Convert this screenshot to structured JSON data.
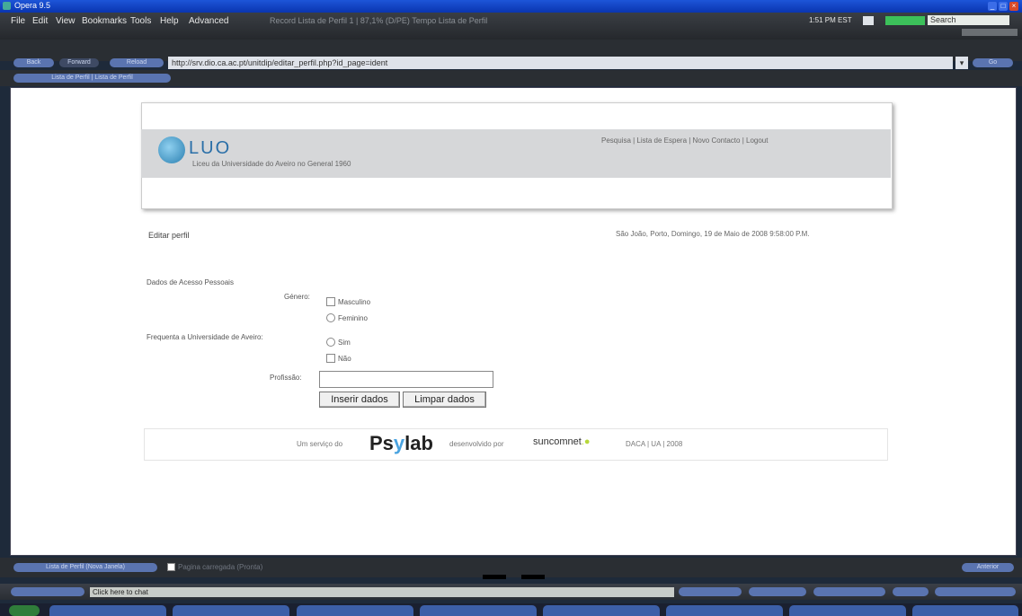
{
  "window": {
    "title": "Opera 9.5"
  },
  "menu": {
    "items": [
      "File",
      "Edit",
      "View",
      "Bookmarks",
      "Tools",
      "Help",
      "Advanced"
    ],
    "faint_text": "Record Lista de Perfil 1 | 87,1%  (D/PE)  Tempo Lista de Perfil",
    "clock": "1:51 PM EST",
    "search_label": "Search"
  },
  "address": {
    "url": "http://srv.dio.ca.ac.pt/unitdip/editar_perfil.php?id_page=ident",
    "btn_back": "Back",
    "btn_fwd": "Forward",
    "btn_reload": "Reload",
    "btn_go": "Go",
    "tab": "Lista de Perfil | Lista de Perfil"
  },
  "site": {
    "logo_text": "LUO",
    "logo_sub": "Liceu da Universidade do Aveiro no General 1960",
    "top_links": "Pesquisa | Lista de Espera | Novo Contacto | Logout",
    "page_title": "Editar perfil",
    "timestamp": "São João, Porto, Domingo, 19 de Maio de 2008 9:58:00 P.M.",
    "form_section": "Dados de Acesso Pessoais",
    "gender_label": "Género:",
    "gender_options": [
      "Masculino",
      "Feminino"
    ],
    "university_label": "Frequenta a Universidade de Aveiro:",
    "university_options": [
      "Sim",
      "Não"
    ],
    "profession_label": "Profissão:",
    "btn_insert": "Inserir dados",
    "btn_clear": "Limpar dados",
    "footer_pre": "Um serviço do",
    "footer_brand": "Psylab",
    "footer_mid": "desenvolvido por",
    "footer_dev": "suncomnet",
    "footer_post": "DACA | UA | 2008"
  },
  "status": {
    "left_pill": "Lista de Perfil (Nova Janela)",
    "text": "Pagina carregada (Pronta)",
    "chat_label": "Click here to chat",
    "right_pill": "Anterior"
  },
  "colors": {
    "accent": "#5a74b0",
    "page_bg": "#ffffff",
    "header_band": "#d6d7d9"
  }
}
